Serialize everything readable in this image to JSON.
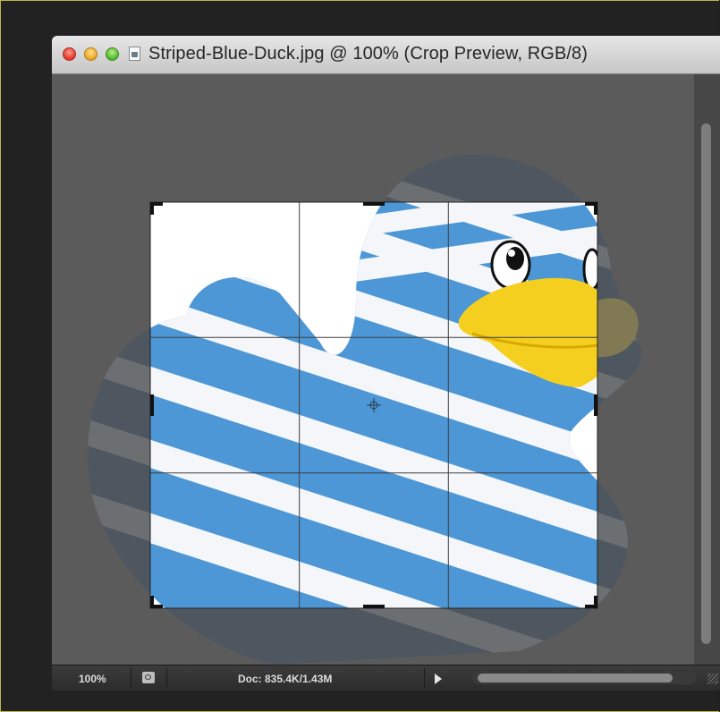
{
  "window": {
    "title": "Striped-Blue-Duck.jpg @ 100% (Crop Preview, RGB/8)"
  },
  "statusbar": {
    "zoom": "100%",
    "doc_size": "Doc: 835.4K/1.43M"
  },
  "icons": {
    "close": "close-icon",
    "minimize": "minimize-icon",
    "zoom": "zoom-icon",
    "document": "document-icon",
    "status": "status-info-icon",
    "play": "play-arrow-icon",
    "resize": "resize-grip-icon"
  },
  "colors": {
    "duck_blue": "#4d97d6",
    "duck_stripe": "#f4f6fa",
    "beak": "#f5cf1f",
    "shield": "#5b5b5b",
    "canvas_bg": "#ffffff"
  }
}
